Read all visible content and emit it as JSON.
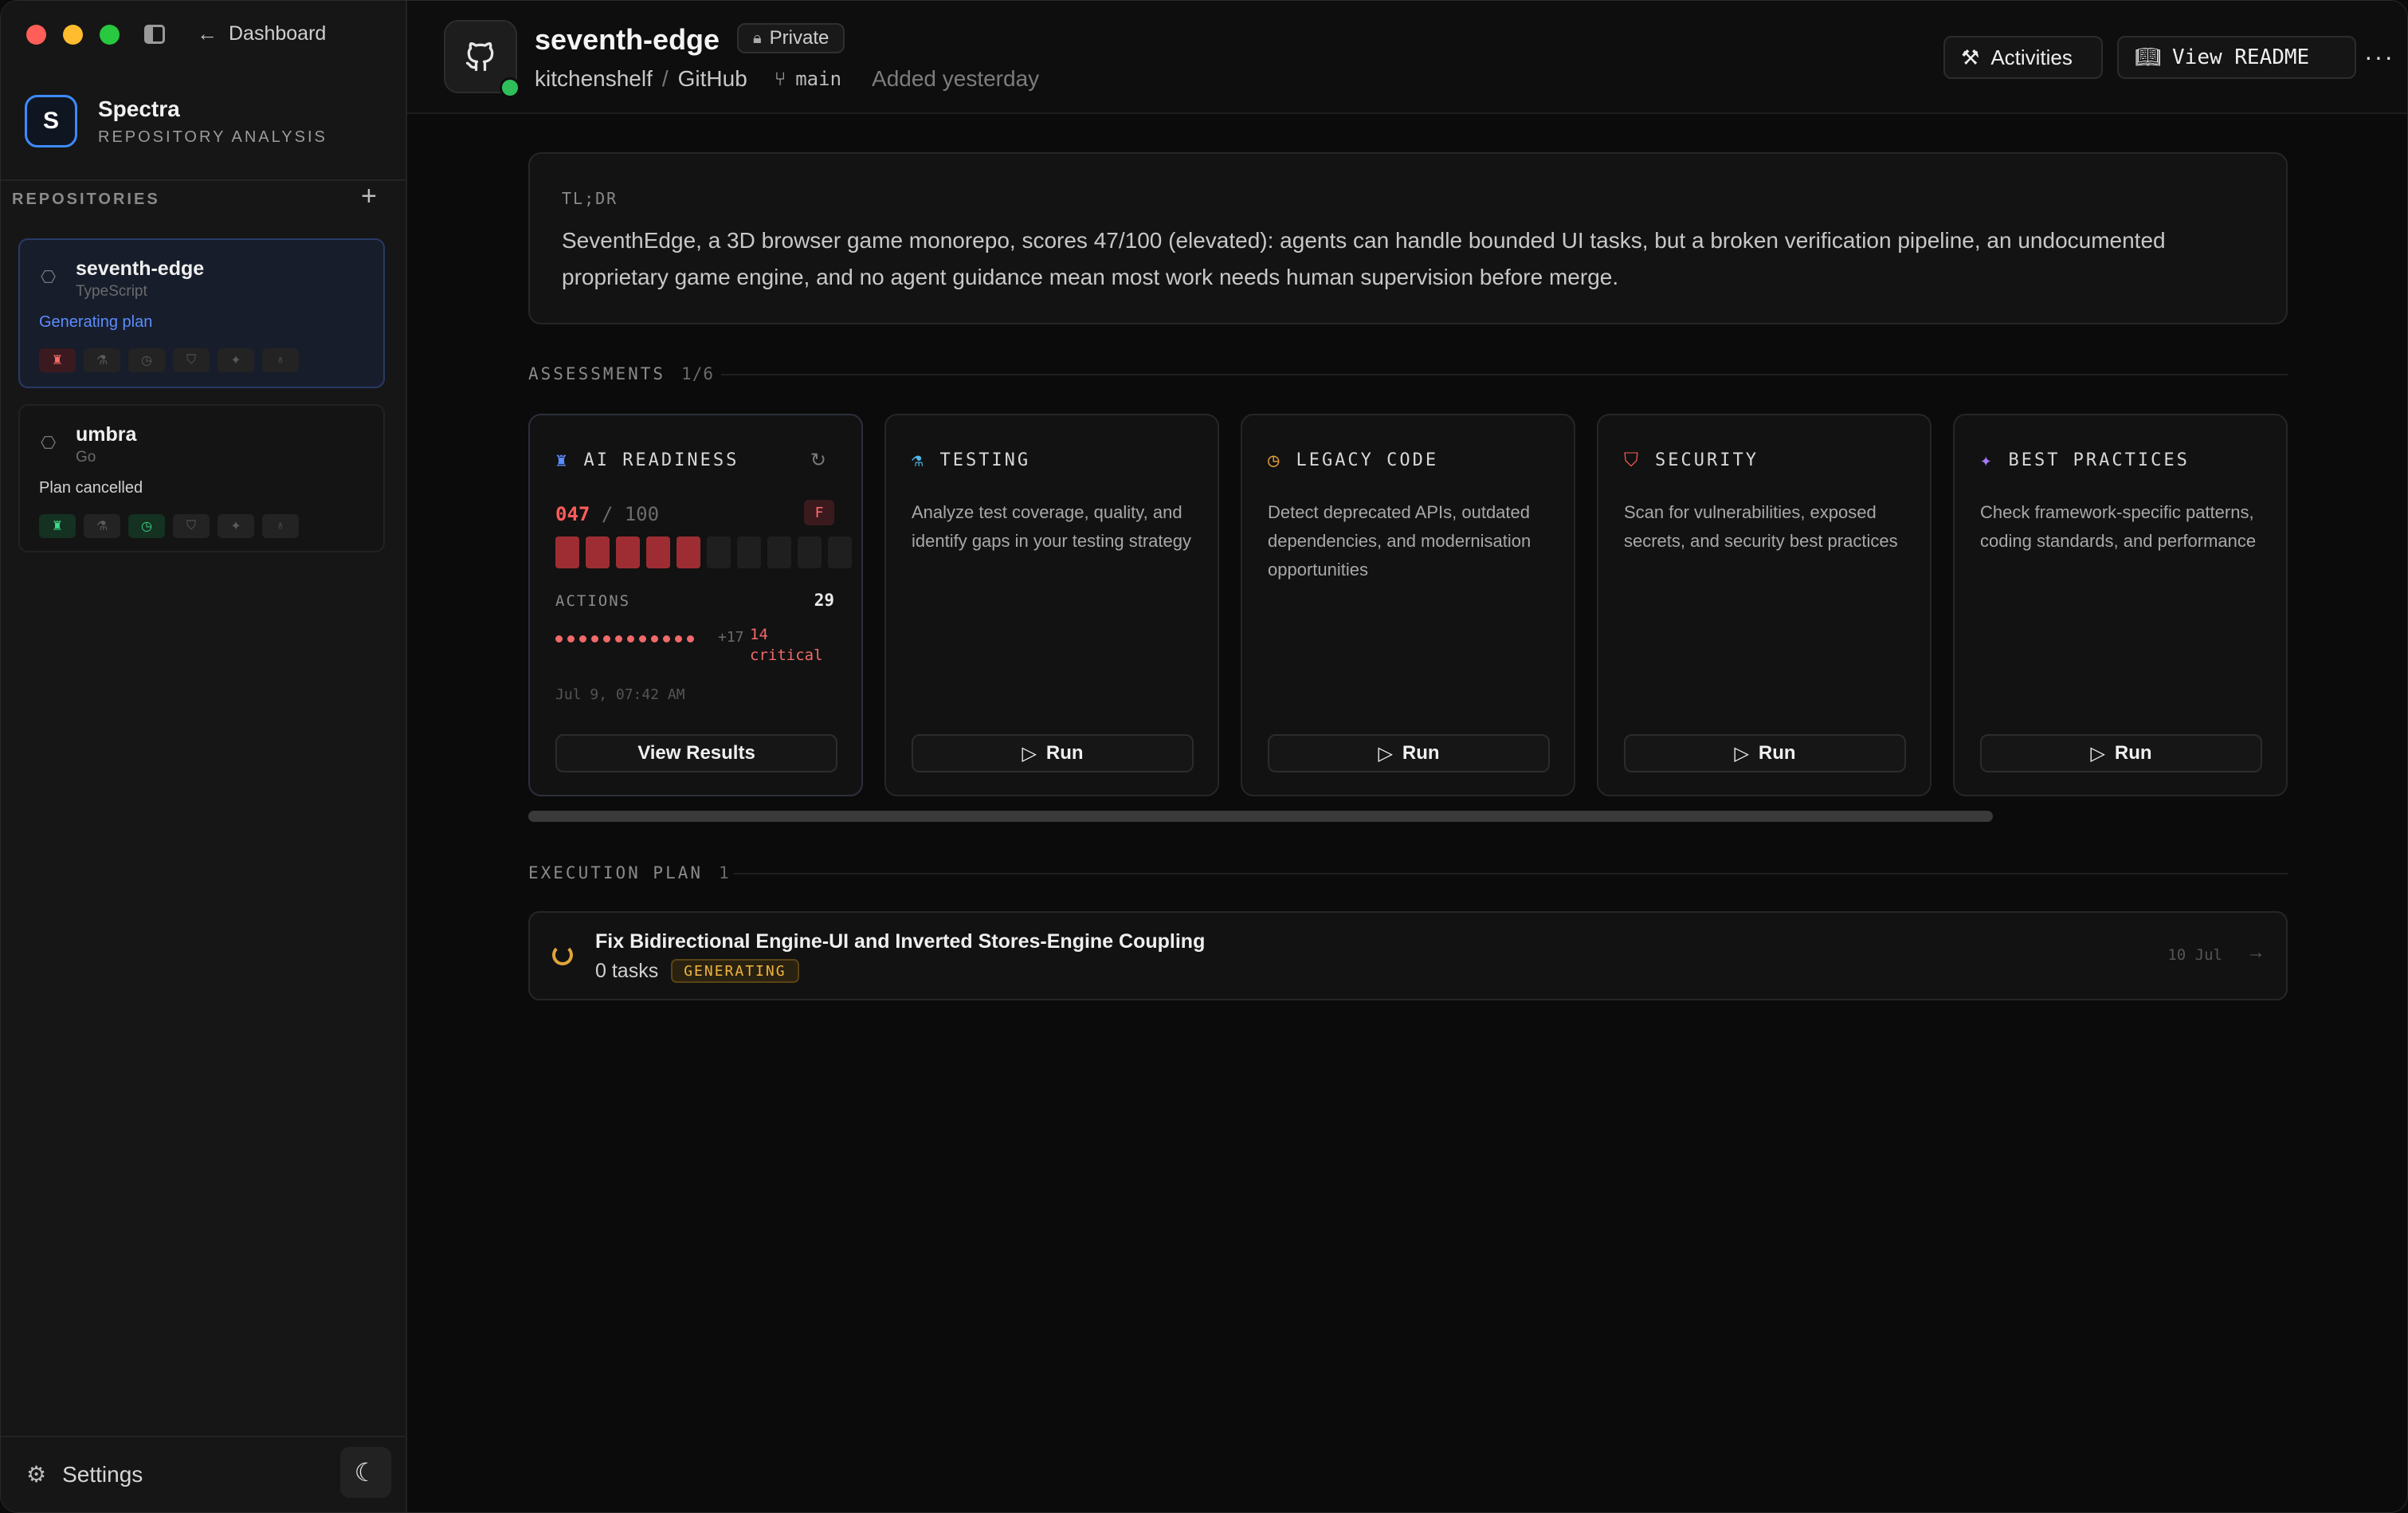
{
  "nav": {
    "back_label": "Dashboard"
  },
  "brand": {
    "logo_letter": "S",
    "name": "Spectra",
    "subtitle": "REPOSITORY ANALYSIS"
  },
  "sidebar": {
    "heading": "REPOSITORIES",
    "add_label": "+",
    "repos": [
      {
        "name": "seventh-edge",
        "language": "TypeScript",
        "status": "Generating plan",
        "status_color": "#5b8dff"
      },
      {
        "name": "umbra",
        "language": "Go",
        "status": "Plan cancelled",
        "status_color": "#d2d2d2"
      }
    ],
    "settings_label": "Settings"
  },
  "header": {
    "title": "seventh-edge",
    "visibility": "Private",
    "owner": "kitchenshelf",
    "provider": "GitHub",
    "branch": "main",
    "added": "Added yesterday",
    "activities_label": "Activities",
    "readme_label": "View README",
    "more_label": "···"
  },
  "tldr": {
    "label": "TL;DR",
    "text": "SeventhEdge, a 3D browser game monorepo, scores 47/100 (elevated): agents can handle bounded UI tasks, but a broken verification pipeline, an undocumented proprietary game engine, and no agent guidance mean most work needs human supervision before merge."
  },
  "assessments": {
    "heading": "ASSESSMENTS",
    "count": "1/6",
    "ai_readiness": {
      "title": "AI READINESS",
      "score": "047",
      "score_max": "/ 100",
      "score_fraction": 0.47,
      "grade": "F",
      "actions_label": "ACTIONS",
      "actions_count": "29",
      "more_dots": "+17",
      "critical": "14 critical",
      "timestamp": "Jul 9, 07:42 AM",
      "button": "View Results",
      "accent": "#ff5b5b"
    },
    "cards": [
      {
        "title": "TESTING",
        "icon": "flask-icon",
        "icon_color": "#4fb6e8",
        "desc": "Analyze test coverage, quality, and identify gaps in your testing strategy",
        "button": "Run"
      },
      {
        "title": "LEGACY CODE",
        "icon": "history-icon",
        "icon_color": "#e8a23a",
        "desc": "Detect deprecated APIs, outdated dependencies, and modernisation opportunities",
        "button": "Run"
      },
      {
        "title": "SECURITY",
        "icon": "shield-icon",
        "icon_color": "#ff5b5b",
        "desc": "Scan for vulnerabilities, exposed secrets, and security best practices",
        "button": "Run"
      },
      {
        "title": "BEST PRACTICES",
        "icon": "sparkle-icon",
        "icon_color": "#a57cff",
        "desc": "Check framework-specific patterns, coding standards, and performance",
        "button": "Run"
      }
    ]
  },
  "execution_plan": {
    "heading": "EXECUTION PLAN",
    "count": "1",
    "items": [
      {
        "title": "Fix Bidirectional Engine-UI and Inverted Stores-Engine Coupling",
        "tasks": "0 tasks",
        "status": "GENERATING",
        "date": "10 Jul"
      }
    ]
  }
}
